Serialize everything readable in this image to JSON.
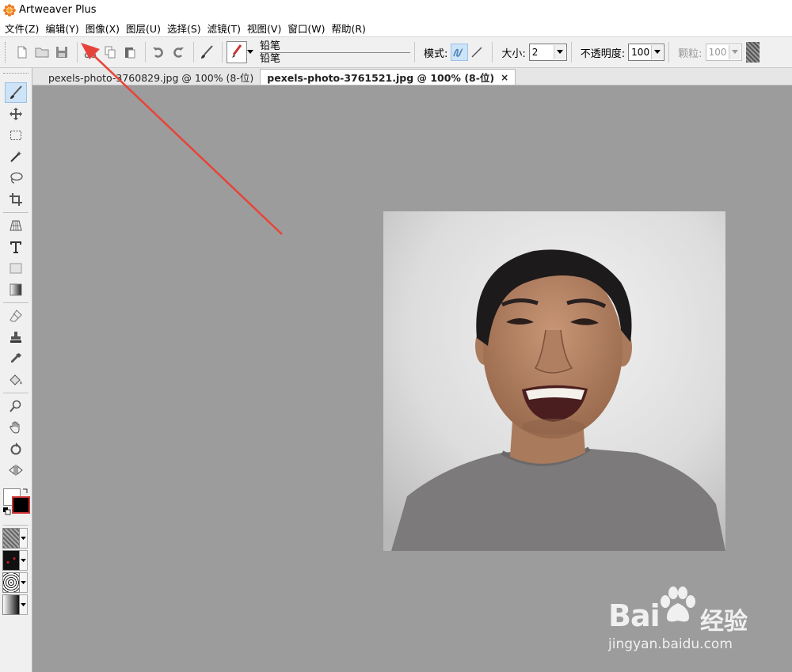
{
  "app": {
    "title": "Artweaver Plus"
  },
  "menu": [
    {
      "label": "文件(Z)"
    },
    {
      "label": "编辑(Y)"
    },
    {
      "label": "图像(X)"
    },
    {
      "label": "图层(U)"
    },
    {
      "label": "选择(S)"
    },
    {
      "label": "滤镜(T)"
    },
    {
      "label": "视图(V)"
    },
    {
      "label": "窗口(W)"
    },
    {
      "label": "帮助(R)"
    }
  ],
  "toolbar": {
    "brush_name_1": "铅笔",
    "brush_name_2": "铅笔",
    "mode_label": "模式:",
    "size_label": "大小:",
    "size_value": "2",
    "opacity_label": "不透明度:",
    "opacity_value": "100",
    "grain_label": "颗粒:",
    "grain_value": "100"
  },
  "tabs": [
    {
      "label": "pexels-photo-3760829.jpg @ 100% (8-位)",
      "active": false
    },
    {
      "label": "pexels-photo-3761521.jpg @ 100% (8-位)",
      "active": true
    }
  ],
  "tab_close": "×",
  "watermark": {
    "brand": "Bai",
    "brand2": "经验",
    "url": "jingyan.baidu.com"
  },
  "colors": {
    "accent": "#cde3f7",
    "canvas_bg": "#9c9c9c",
    "arrow": "#e8433a"
  }
}
